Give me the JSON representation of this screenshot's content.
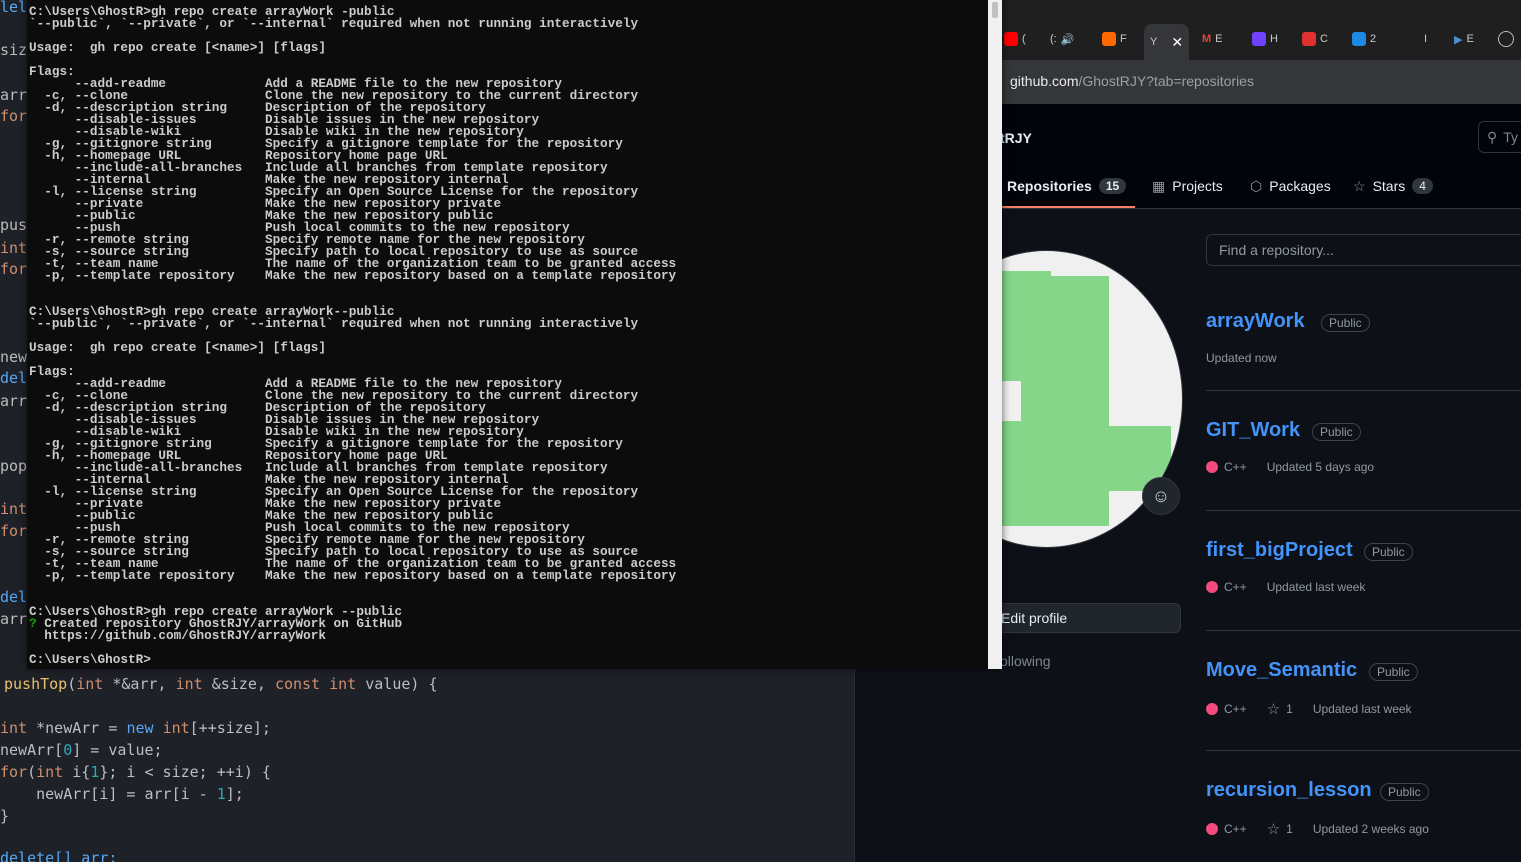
{
  "editor": {
    "fragments": [
      "lele",
      "size",
      "arr",
      "for(",
      "push",
      "int",
      "for(",
      "newA",
      "dele",
      "arr",
      "pop",
      "int",
      "for(",
      "dele",
      "arr"
    ],
    "line1": {
      "kw1": "pushTop",
      "p1": "(",
      "t1": "int",
      "p2": " *&arr, ",
      "t2": "int",
      "p3": " &size, ",
      "t3": "const",
      "p4": " ",
      "t4": "int",
      "p5": " value) {"
    },
    "line2": {
      "t": "int",
      "p": " *newArr = ",
      "kw": "new",
      "p2": " ",
      "t2": "int",
      "p3": "[++size];"
    },
    "line3": {
      "a": "newArr[",
      "n": "0",
      "b": "] = value;"
    },
    "line4": {
      "a": "for",
      "b": "(",
      "t": "int",
      "c": " i{",
      "n": "1",
      "d": "}; i < size; ++i) {"
    },
    "line5": {
      "a": "    newArr[i] = arr[i - ",
      "n": "1",
      "b": "];"
    },
    "line6": "}",
    "line7": "delete[] arr;"
  },
  "terminal": {
    "lines": [
      "C:\\Users\\GhostR>gh repo create arrayWork -public",
      "`--public`, `--private`, or `--internal` required when not running interactively",
      "",
      "Usage:  gh repo create [<name>] [flags]",
      "",
      "Flags:",
      "      --add-readme             Add a README file to the new repository",
      "  -c, --clone                  Clone the new repository to the current directory",
      "  -d, --description string     Description of the repository",
      "      --disable-issues         Disable issues in the new repository",
      "      --disable-wiki           Disable wiki in the new repository",
      "  -g, --gitignore string       Specify a gitignore template for the repository",
      "  -h, --homepage URL           Repository home page URL",
      "      --include-all-branches   Include all branches from template repository",
      "      --internal               Make the new repository internal",
      "  -l, --license string         Specify an Open Source License for the repository",
      "      --private                Make the new repository private",
      "      --public                 Make the new repository public",
      "      --push                   Push local commits to the new repository",
      "  -r, --remote string          Specify remote name for the new repository",
      "  -s, --source string          Specify path to local repository to use as source",
      "  -t, --team name              The name of the organization team to be granted access",
      "  -p, --template repository    Make the new repository based on a template repository",
      "",
      "",
      "C:\\Users\\GhostR>gh repo create arrayWork--public",
      "`--public`, `--private`, or `--internal` required when not running interactively",
      "",
      "Usage:  gh repo create [<name>] [flags]",
      "",
      "Flags:",
      "      --add-readme             Add a README file to the new repository",
      "  -c, --clone                  Clone the new repository to the current directory",
      "  -d, --description string     Description of the repository",
      "      --disable-issues         Disable issues in the new repository",
      "      --disable-wiki           Disable wiki in the new repository",
      "  -g, --gitignore string       Specify a gitignore template for the repository",
      "  -h, --homepage URL           Repository home page URL",
      "      --include-all-branches   Include all branches from template repository",
      "      --internal               Make the new repository internal",
      "  -l, --license string         Specify an Open Source License for the repository",
      "      --private                Make the new repository private",
      "      --public                 Make the new repository public",
      "      --push                   Push local commits to the new repository",
      "  -r, --remote string          Specify remote name for the new repository",
      "  -s, --source string          Specify path to local repository to use as source",
      "  -t, --team name              The name of the organization team to be granted access",
      "  -p, --template repository    Make the new repository based on a template repository",
      "",
      "",
      "C:\\Users\\GhostR>gh repo create arrayWork --public",
      "? Created repository GhostRJY/arrayWork on GitHub",
      "  https://github.com/GhostRJY/arrayWork",
      "",
      "C:\\Users\\GhostR>"
    ]
  },
  "browser": {
    "tabs": [
      {
        "icon": "youtube-icon",
        "label": "(",
        "color": "#ff0000"
      },
      {
        "icon": "audio-icon",
        "label": "(:",
        "color": "#888888"
      },
      {
        "icon": "app-icon",
        "label": "F",
        "color": "#ff6a00"
      },
      {
        "icon": "github-icon",
        "label": "Y",
        "color": "#ffffff",
        "active": true
      },
      {
        "icon": "gmail-icon",
        "label": "E",
        "color": "#ea4335"
      },
      {
        "icon": "app-m-icon",
        "label": "H",
        "color": "#6f42ff"
      },
      {
        "icon": "app-red-icon",
        "label": "C",
        "color": "#e03030"
      },
      {
        "icon": "app-blue-icon",
        "label": "2",
        "color": "#1e88e5"
      },
      {
        "icon": "blank-icon",
        "label": "I",
        "color": "#1f1f1f"
      },
      {
        "icon": "play-icon",
        "label": "E",
        "color": "#4a90d9"
      },
      {
        "icon": "settings-icon",
        "label": "",
        "color": "#bbbbbb"
      }
    ],
    "url_host": "github.com",
    "url_path": "/GhostRJY?tab=repositories",
    "username": "tRJY",
    "search_text": "Ty",
    "nav": {
      "repositories": "Repositories",
      "repositories_count": "15",
      "projects": "Projects",
      "packages": "Packages",
      "stars": "Stars",
      "stars_count": "4"
    },
    "find_placeholder": "Find a repository...",
    "edit_profile": "Edit profile",
    "following": "ollowing",
    "repos": [
      {
        "name": "arrayWork",
        "visibility": "Public",
        "lang": "",
        "stars": "",
        "updated": "Updated now"
      },
      {
        "name": "GIT_Work",
        "visibility": "Public",
        "lang": "C++",
        "stars": "",
        "updated": "Updated 5 days ago"
      },
      {
        "name": "first_bigProject",
        "visibility": "Public",
        "lang": "C++",
        "stars": "",
        "updated": "Updated last week"
      },
      {
        "name": "Move_Semantic",
        "visibility": "Public",
        "lang": "C++",
        "stars": "1",
        "updated": "Updated last week"
      },
      {
        "name": "recursion_lesson",
        "visibility": "Public",
        "lang": "C++",
        "stars": "1",
        "updated": "Updated 2 weeks ago"
      }
    ],
    "colors": {
      "link": "#4493f8",
      "cpp": "#f34b7d",
      "avatar_green": "#85d689"
    }
  }
}
